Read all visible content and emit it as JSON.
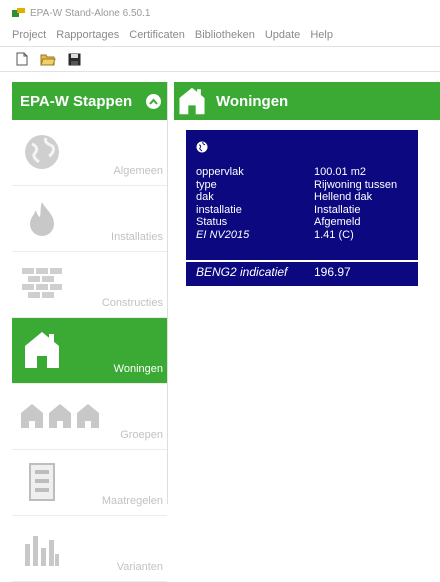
{
  "window": {
    "title": "EPA-W Stand-Alone 6.50.1"
  },
  "menu": [
    "Project",
    "Rapportages",
    "Certificaten",
    "Bibliotheken",
    "Update",
    "Help"
  ],
  "toolbar": {
    "buttons": [
      "new-file-icon",
      "open-folder-icon",
      "save-disk-icon"
    ]
  },
  "sidebar": {
    "title": "EPA-W Stappen",
    "items": [
      {
        "label": "Algemeen",
        "icon": "globe-icon"
      },
      {
        "label": "Installaties",
        "icon": "flame-icon"
      },
      {
        "label": "Constructies",
        "icon": "wall-icon"
      },
      {
        "label": "Woningen",
        "icon": "house-icon",
        "active": true
      },
      {
        "label": "Groepen",
        "icon": "houses-group-icon"
      },
      {
        "label": "Maatregelen",
        "icon": "measures-icon"
      },
      {
        "label": "Varianten",
        "icon": "bar-chart-icon"
      }
    ]
  },
  "main": {
    "title": "Woningen",
    "card": {
      "rows": [
        {
          "key": "oppervlak",
          "value": "100.01 m2"
        },
        {
          "key": "type",
          "value": "Rijwoning tussen"
        },
        {
          "key": "dak",
          "value": "Hellend dak"
        },
        {
          "key": "installatie",
          "value": "Installatie"
        },
        {
          "key": "Status",
          "value": "Afgemeld"
        },
        {
          "key": "EI NV2015",
          "value": "1.41 (C)",
          "italic_key": true
        }
      ],
      "beng": {
        "key": "BENG2 indicatief",
        "value": "196.97"
      }
    }
  },
  "colors": {
    "accent": "#3aaa35",
    "card_bg": "#0b0880"
  }
}
